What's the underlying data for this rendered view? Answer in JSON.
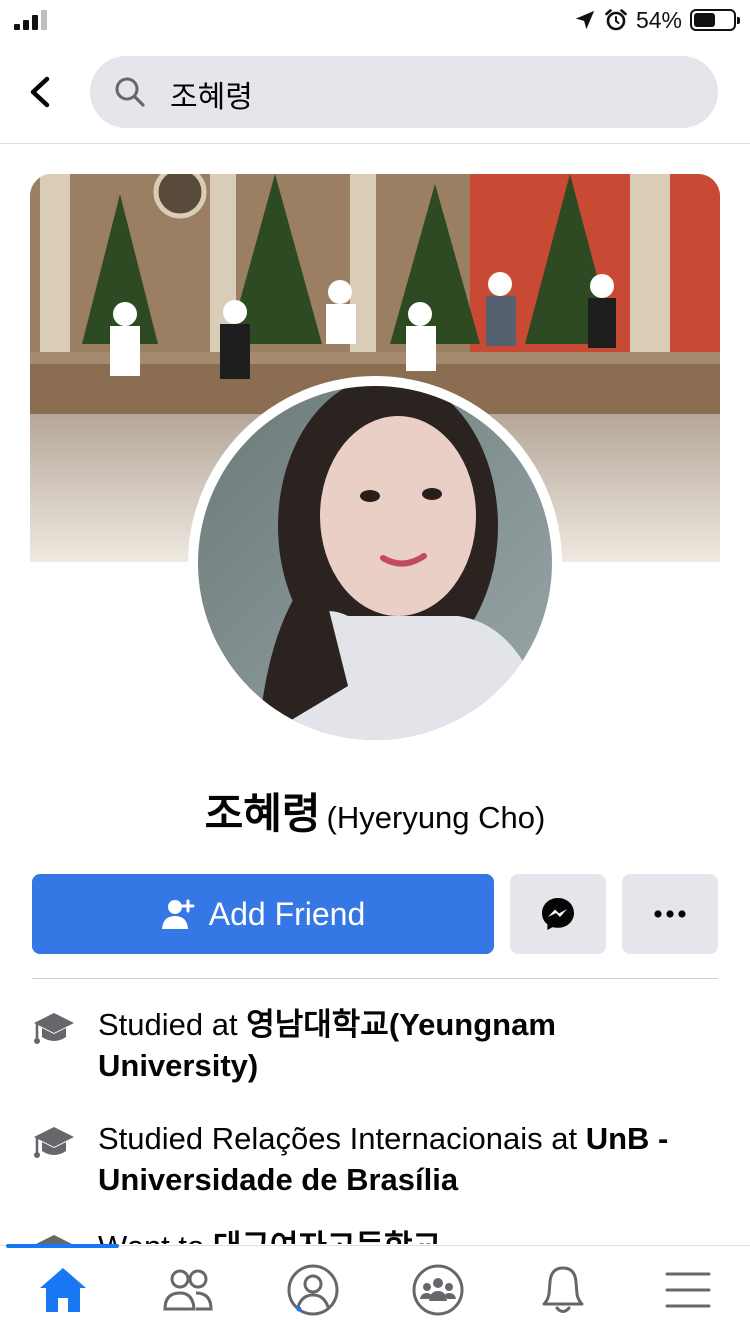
{
  "status_bar": {
    "battery_text": "54%",
    "battery_level": 0.54,
    "signal_bars_active": 3,
    "icons": [
      "cellular-signal-icon",
      "location-arrow-icon",
      "alarm-icon",
      "battery-icon"
    ]
  },
  "header": {
    "back_icon": "chevron-left-icon",
    "search_icon": "search-icon",
    "search_value": "조혜령"
  },
  "profile": {
    "name": "조혜령",
    "alternate_name": "(Hyeryung Cho)"
  },
  "actions": {
    "add_friend_label": "Add Friend",
    "add_friend_icon": "add-person-icon",
    "messenger_icon": "messenger-icon",
    "more_icon": "ellipsis-icon",
    "primary_color": "#3578e5"
  },
  "details": [
    {
      "icon": "graduation-cap-icon",
      "prefix": "Studied at ",
      "bold": "영남대학교(Yeungnam University)"
    },
    {
      "icon": "graduation-cap-icon",
      "prefix": "Studied Relações Internacionais at ",
      "bold": "UnB - Universidade de Brasília"
    },
    {
      "icon": "graduation-cap-icon",
      "prefix": "Went to ",
      "bold": "대구여자고등학교"
    }
  ],
  "tab_bar": {
    "active_color": "#1877f2",
    "tabs": [
      "home-icon",
      "friends-icon",
      "profile-icon",
      "groups-icon",
      "notifications-icon",
      "menu-icon"
    ]
  }
}
